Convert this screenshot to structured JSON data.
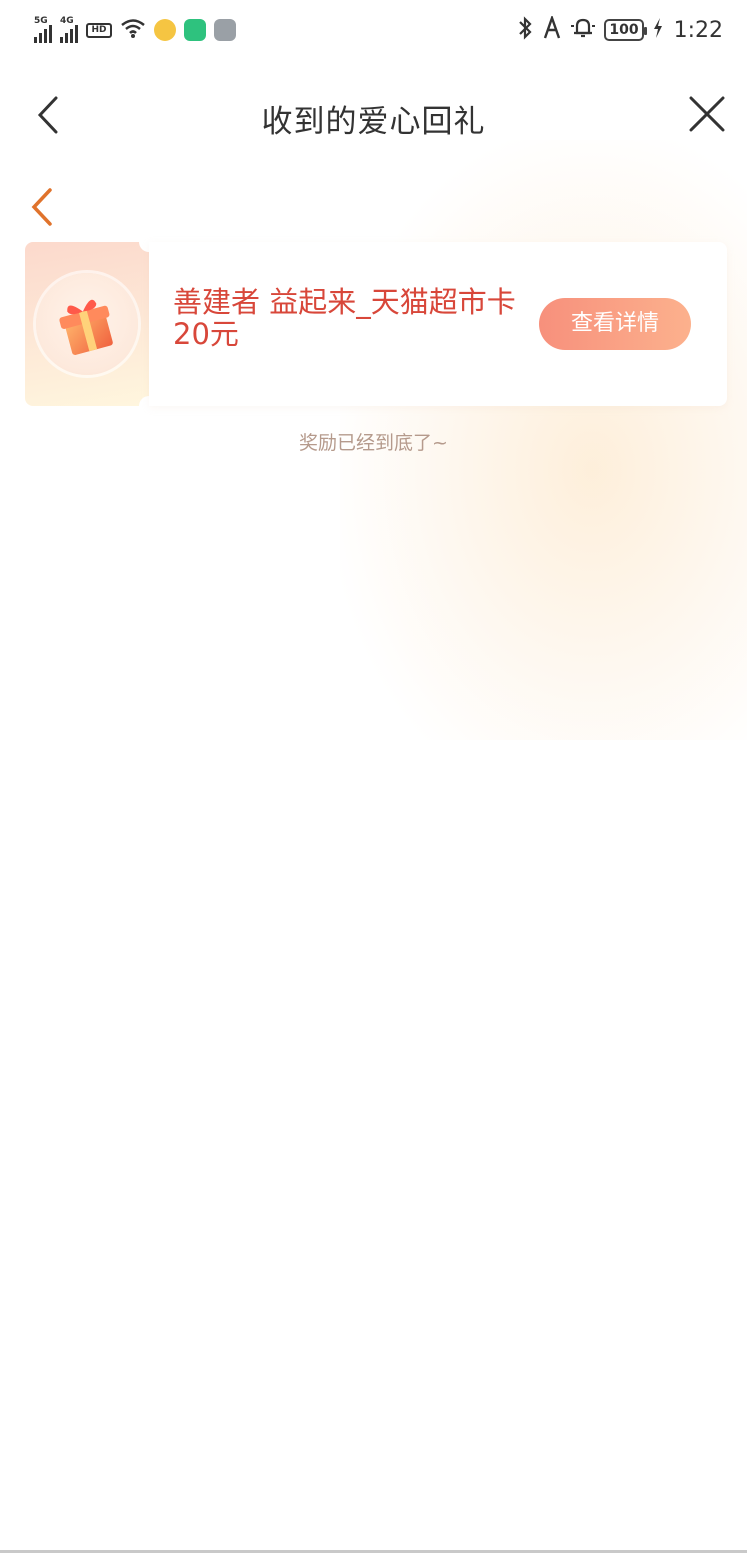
{
  "status_bar": {
    "signal1_tag": "5G",
    "signal2_tag": "4G",
    "hd_tag": "HD",
    "battery": "100",
    "time": "1:22"
  },
  "nav": {
    "title": "收到的爱心回礼"
  },
  "reward_list": [
    {
      "title": "善建者 益起来_天猫超市卡20元",
      "button": "查看详情"
    }
  ],
  "footer_note": "奖励已经到底了~",
  "colors": {
    "title_red": "#d8473a",
    "button_start": "#f7907c",
    "button_end": "#fcb18d",
    "back_orange": "#e0732c",
    "footer_text": "#b59a8c"
  }
}
